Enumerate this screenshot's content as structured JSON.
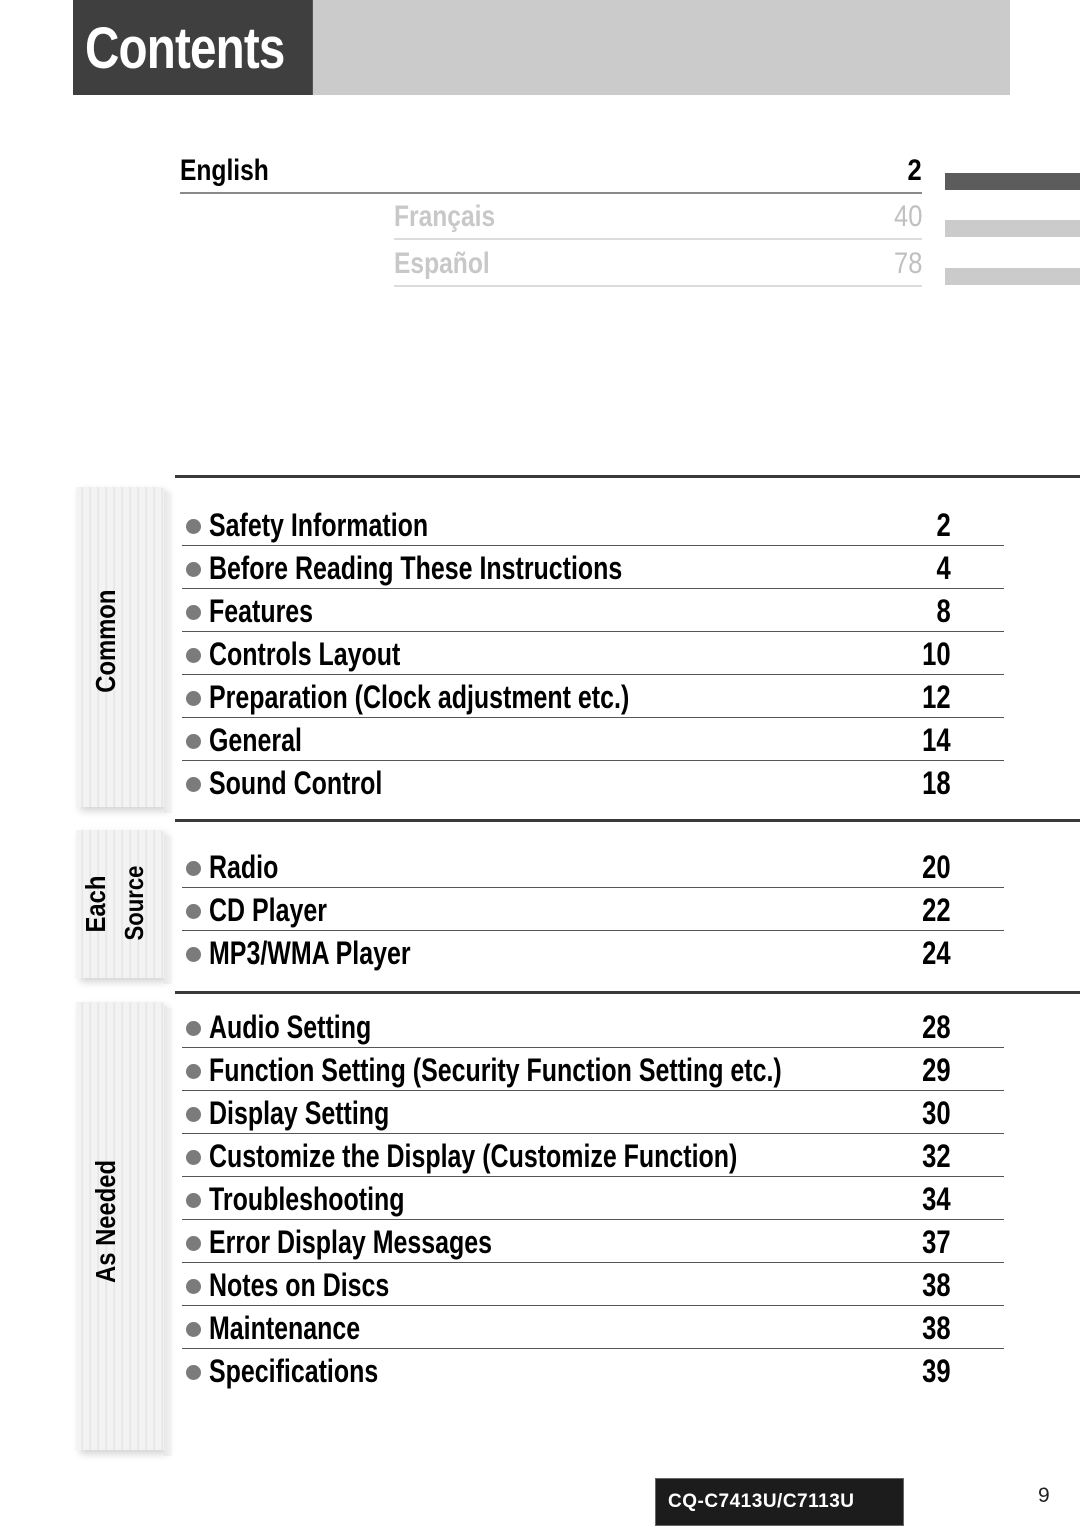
{
  "header": {
    "title": "Contents"
  },
  "languages": [
    {
      "label": "English",
      "page": "2",
      "active": true
    },
    {
      "label": "Français",
      "page": "40",
      "active": false
    },
    {
      "label": "Español",
      "page": "78",
      "active": false
    }
  ],
  "sections": [
    {
      "tab_label_lines": [
        "Common"
      ],
      "items": [
        {
          "title": "Safety Information",
          "page": "2"
        },
        {
          "title": "Before Reading These Instructions",
          "page": "4"
        },
        {
          "title": "Features",
          "page": "8"
        },
        {
          "title": "Controls Layout",
          "page": "10"
        },
        {
          "title": "Preparation (Clock adjustment etc.)",
          "page": "12"
        },
        {
          "title": "General",
          "page": "14"
        },
        {
          "title": "Sound Control",
          "page": "18"
        }
      ]
    },
    {
      "tab_label_lines": [
        "Each",
        "Source"
      ],
      "items": [
        {
          "title": "Radio",
          "page": "20"
        },
        {
          "title": "CD Player",
          "page": "22"
        },
        {
          "title": "MP3/WMA Player",
          "page": "24"
        }
      ]
    },
    {
      "tab_label_lines": [
        "As Needed"
      ],
      "items": [
        {
          "title": "Audio Setting",
          "page": "28"
        },
        {
          "title": "Function Setting (Security Function Setting etc.)",
          "page": "29"
        },
        {
          "title": "Display Setting",
          "page": "30"
        },
        {
          "title": "Customize the Display (Customize Function)",
          "page": "32"
        },
        {
          "title": "Troubleshooting",
          "page": "34"
        },
        {
          "title": "Error Display Messages",
          "page": "37"
        },
        {
          "title": "Notes on Discs",
          "page": "38"
        },
        {
          "title": "Maintenance",
          "page": "38"
        },
        {
          "title": "Specifications",
          "page": "39"
        }
      ]
    }
  ],
  "footer": {
    "model": "CQ-C7413U/C7113U",
    "page_number": "9"
  },
  "colors": {
    "header_dark": "#3f3f3f",
    "header_light": "#cbcbcb",
    "active_tab": "#5c5c5c",
    "inactive_tab": "#cbcbcb",
    "bullet": "#7b7b7b"
  }
}
